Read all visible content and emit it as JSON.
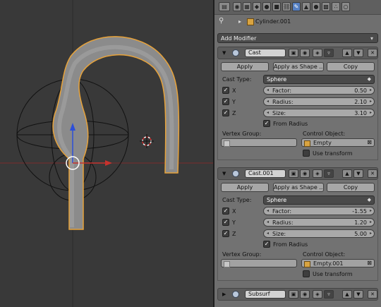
{
  "context_tabs": [
    "render",
    "layers",
    "scene",
    "world",
    "object",
    "constraints",
    "modifiers",
    "data",
    "material",
    "texture",
    "particles",
    "physics"
  ],
  "breadcrumb": {
    "object_name": "Cylinder.001"
  },
  "add_modifier": {
    "label": "Add Modifier"
  },
  "modifiers": [
    {
      "name": "Cast",
      "apply_label": "Apply",
      "apply_shape_label": "Apply as Shape ...",
      "copy_label": "Copy",
      "cast_type_label": "Cast Type:",
      "cast_type_value": "Sphere",
      "axes": [
        {
          "label": "X",
          "checked": true
        },
        {
          "label": "Y",
          "checked": true
        },
        {
          "label": "Z",
          "checked": true
        }
      ],
      "fields": [
        {
          "label": "Factor:",
          "value": "0.50"
        },
        {
          "label": "Radius:",
          "value": "2.10"
        },
        {
          "label": "Size:",
          "value": "3.10"
        }
      ],
      "from_radius_label": "From Radius",
      "from_radius_checked": true,
      "vertex_group_label": "Vertex Group:",
      "vertex_group_value": "",
      "control_object_label": "Control Object:",
      "control_object_value": "Empty",
      "use_transform_label": "Use transform",
      "use_transform_checked": false
    },
    {
      "name": "Cast.001",
      "apply_label": "Apply",
      "apply_shape_label": "Apply as Shape ...",
      "copy_label": "Copy",
      "cast_type_label": "Cast Type:",
      "cast_type_value": "Sphere",
      "axes": [
        {
          "label": "X",
          "checked": true
        },
        {
          "label": "Y",
          "checked": true
        },
        {
          "label": "Z",
          "checked": true
        }
      ],
      "fields": [
        {
          "label": "Factor:",
          "value": "-1.55"
        },
        {
          "label": "Radius:",
          "value": "1.20"
        },
        {
          "label": "Size:",
          "value": "5.00"
        }
      ],
      "from_radius_label": "From Radius",
      "from_radius_checked": true,
      "vertex_group_label": "Vertex Group:",
      "vertex_group_value": "",
      "control_object_label": "Control Object:",
      "control_object_value": "Empty.001",
      "use_transform_label": "Use transform",
      "use_transform_checked": false
    }
  ],
  "collapsed_modifier": {
    "name": "Subsurf"
  },
  "colors": {
    "viewport_bg": "#393939",
    "panel_bg": "#6f6f6f",
    "active_tab": "#5680c2",
    "selection_outline": "#e8a33a",
    "x_axis": "#c8322d",
    "y_axis": "#2f7f2f",
    "z_axis": "#2d4fd8"
  }
}
